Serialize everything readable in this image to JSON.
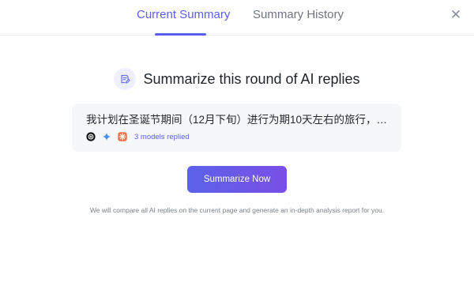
{
  "tabs": {
    "current_label": "Current Summary",
    "history_label": "Summary History",
    "close_icon": "close-icon",
    "accent_color": "#5b5ef0"
  },
  "main": {
    "heading_icon": "summary-edit-icon",
    "heading": "Summarize this round of AI replies",
    "prompt_preview": "我计划在圣诞节期间（12月下旬）进行为期10天左右的旅行，目...",
    "model_icons": [
      "chatgpt-icon",
      "gemini-icon",
      "claude-icon"
    ],
    "models_replied": "3 models replied",
    "summarize_button": "Summarize Now",
    "note": "We will compare all AI replies on the current page and generate an in-depth analysis report for you."
  }
}
